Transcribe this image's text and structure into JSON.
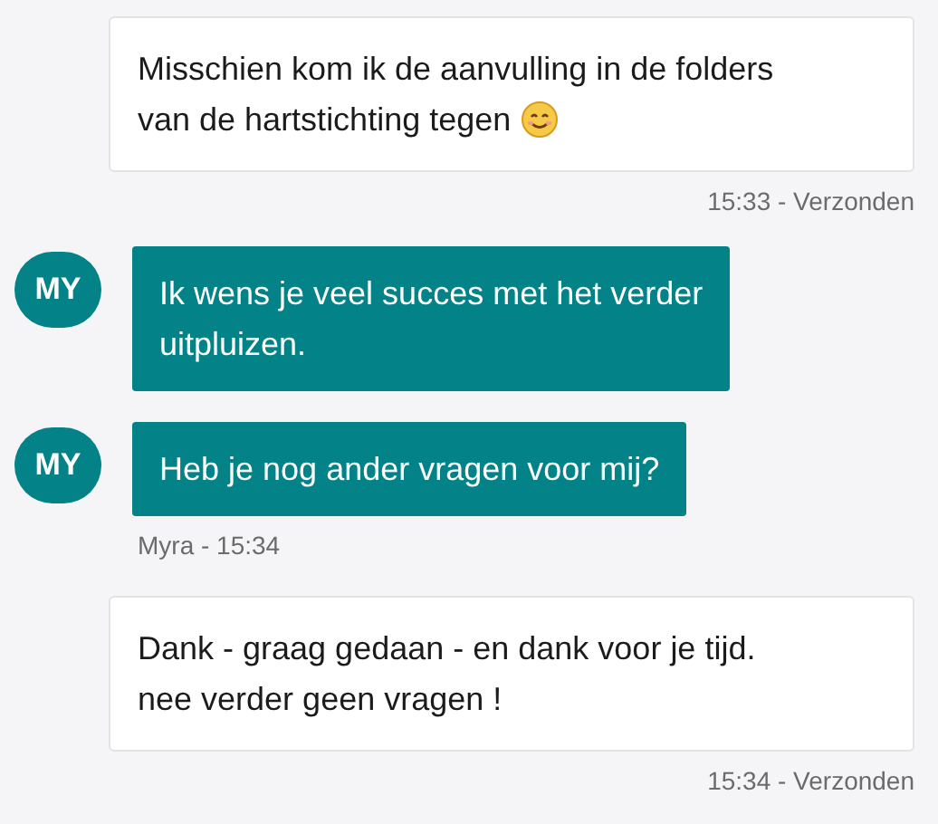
{
  "messages": [
    {
      "kind": "outgoing",
      "lines": [
        "Misschien kom ik de aanvulling in de folders",
        "van de hartstichting tegen"
      ],
      "smiley": true,
      "meta": "15:33 - Verzonden"
    },
    {
      "kind": "incoming",
      "avatar": "MY",
      "lines": [
        "Ik wens je veel succes met het verder",
        "uitpluizen."
      ]
    },
    {
      "kind": "incoming",
      "avatar": "MY",
      "lines": [
        "Heb je nog ander vragen voor mij?"
      ],
      "meta": "Myra - 15:34"
    },
    {
      "kind": "outgoing",
      "lines": [
        "Dank - graag gedaan - en dank voor je tijd.",
        "nee verder geen vragen !"
      ],
      "meta": "15:34 - Verzonden"
    }
  ]
}
